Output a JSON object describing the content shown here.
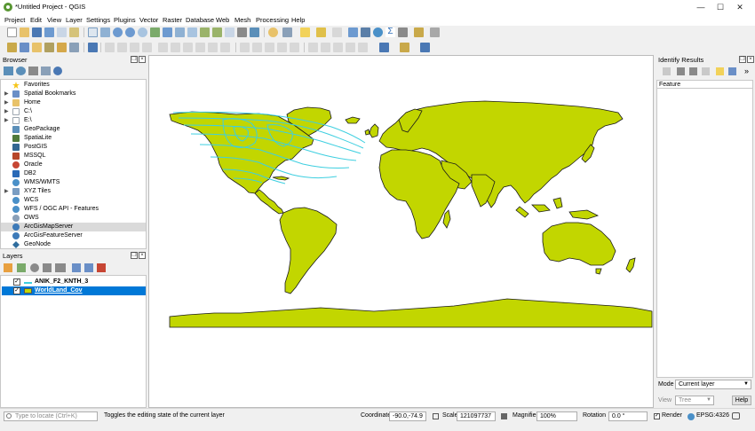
{
  "window": {
    "title": "*Untitled Project - QGIS",
    "min": "—",
    "max": "☐",
    "close": "✕"
  },
  "menu": [
    "Project",
    "Edit",
    "View",
    "Layer",
    "Settings",
    "Plugins",
    "Vector",
    "Raster",
    "Database",
    "Web",
    "Mesh",
    "Processing",
    "Help"
  ],
  "browser": {
    "title": "Browser",
    "items": [
      {
        "label": "Favorites",
        "icon": "star-icon",
        "color": "#f5c518",
        "arrow": ""
      },
      {
        "label": "Spatial Bookmarks",
        "icon": "bookmark-icon",
        "color": "#6a8fc7",
        "arrow": "▶"
      },
      {
        "label": "Home",
        "icon": "folder-icon",
        "color": "#e8c26a",
        "arrow": "▶"
      },
      {
        "label": "C:\\",
        "icon": "drive-icon",
        "color": "#9ea7b0",
        "arrow": "▶"
      },
      {
        "label": "E:\\",
        "icon": "drive-icon",
        "color": "#9ea7b0",
        "arrow": "▶"
      },
      {
        "label": "GeoPackage",
        "icon": "geopackage-icon",
        "color": "#5b8fb9",
        "arrow": ""
      },
      {
        "label": "SpatiaLite",
        "icon": "spatialite-icon",
        "color": "#4f7a3a",
        "arrow": ""
      },
      {
        "label": "PostGIS",
        "icon": "postgis-icon",
        "color": "#336791",
        "arrow": ""
      },
      {
        "label": "MSSQL",
        "icon": "mssql-icon",
        "color": "#b7472a",
        "arrow": ""
      },
      {
        "label": "Oracle",
        "icon": "oracle-icon",
        "color": "#c74634",
        "arrow": ""
      },
      {
        "label": "DB2",
        "icon": "db2-icon",
        "color": "#2a6ab7",
        "arrow": ""
      },
      {
        "label": "WMS/WMTS",
        "icon": "wms-icon",
        "color": "#4a90c8",
        "arrow": ""
      },
      {
        "label": "XYZ Tiles",
        "icon": "xyz-tiles-icon",
        "color": "#7a9dc2",
        "arrow": "▶"
      },
      {
        "label": "WCS",
        "icon": "wcs-icon",
        "color": "#4a90c8",
        "arrow": ""
      },
      {
        "label": "WFS / OGC API - Features",
        "icon": "wfs-icon",
        "color": "#4a90c8",
        "arrow": ""
      },
      {
        "label": "OWS",
        "icon": "ows-icon",
        "color": "#8aa0b8",
        "arrow": ""
      },
      {
        "label": "ArcGisMapServer",
        "icon": "arcgis-map-icon",
        "color": "#3d7ab8",
        "arrow": ""
      },
      {
        "label": "ArcGisFeatureServer",
        "icon": "arcgis-feature-icon",
        "color": "#3d7ab8",
        "arrow": ""
      },
      {
        "label": "GeoNode",
        "icon": "geonode-icon",
        "color": "#2f6d9e",
        "arrow": ""
      }
    ]
  },
  "layers": {
    "title": "Layers",
    "items": [
      {
        "label": "ANIK_F2_KNTH_3",
        "symbol": "line",
        "color": "#3ecfe0",
        "checked": "✓"
      },
      {
        "label": "WorldLand_Cov",
        "symbol": "fill",
        "color": "#c2d600",
        "checked": "✓"
      }
    ]
  },
  "identify": {
    "title": "Identify Results",
    "feature_header": "Feature",
    "mode_label": "Mode",
    "mode_value": "Current layer",
    "view_label": "View",
    "view_value": "Tree",
    "help": "Help"
  },
  "status": {
    "locator_placeholder": "Type to locate (Ctrl+K)",
    "message": "Toggles the editing state of the current layer",
    "coordinate_label": "Coordinate",
    "coordinate_value": "-90.0,-74.9",
    "scale_label": "Scale",
    "scale_value": "121097737",
    "magnifier_label": "Magnifier",
    "magnifier_value": "100%",
    "rotation_label": "Rotation",
    "rotation_value": "0.0 °",
    "render_label": "Render",
    "crs": "EPSG:4326"
  },
  "colors": {
    "land": "#c2d600",
    "footprint": "#3ecfe0",
    "selection": "#0078d7"
  }
}
